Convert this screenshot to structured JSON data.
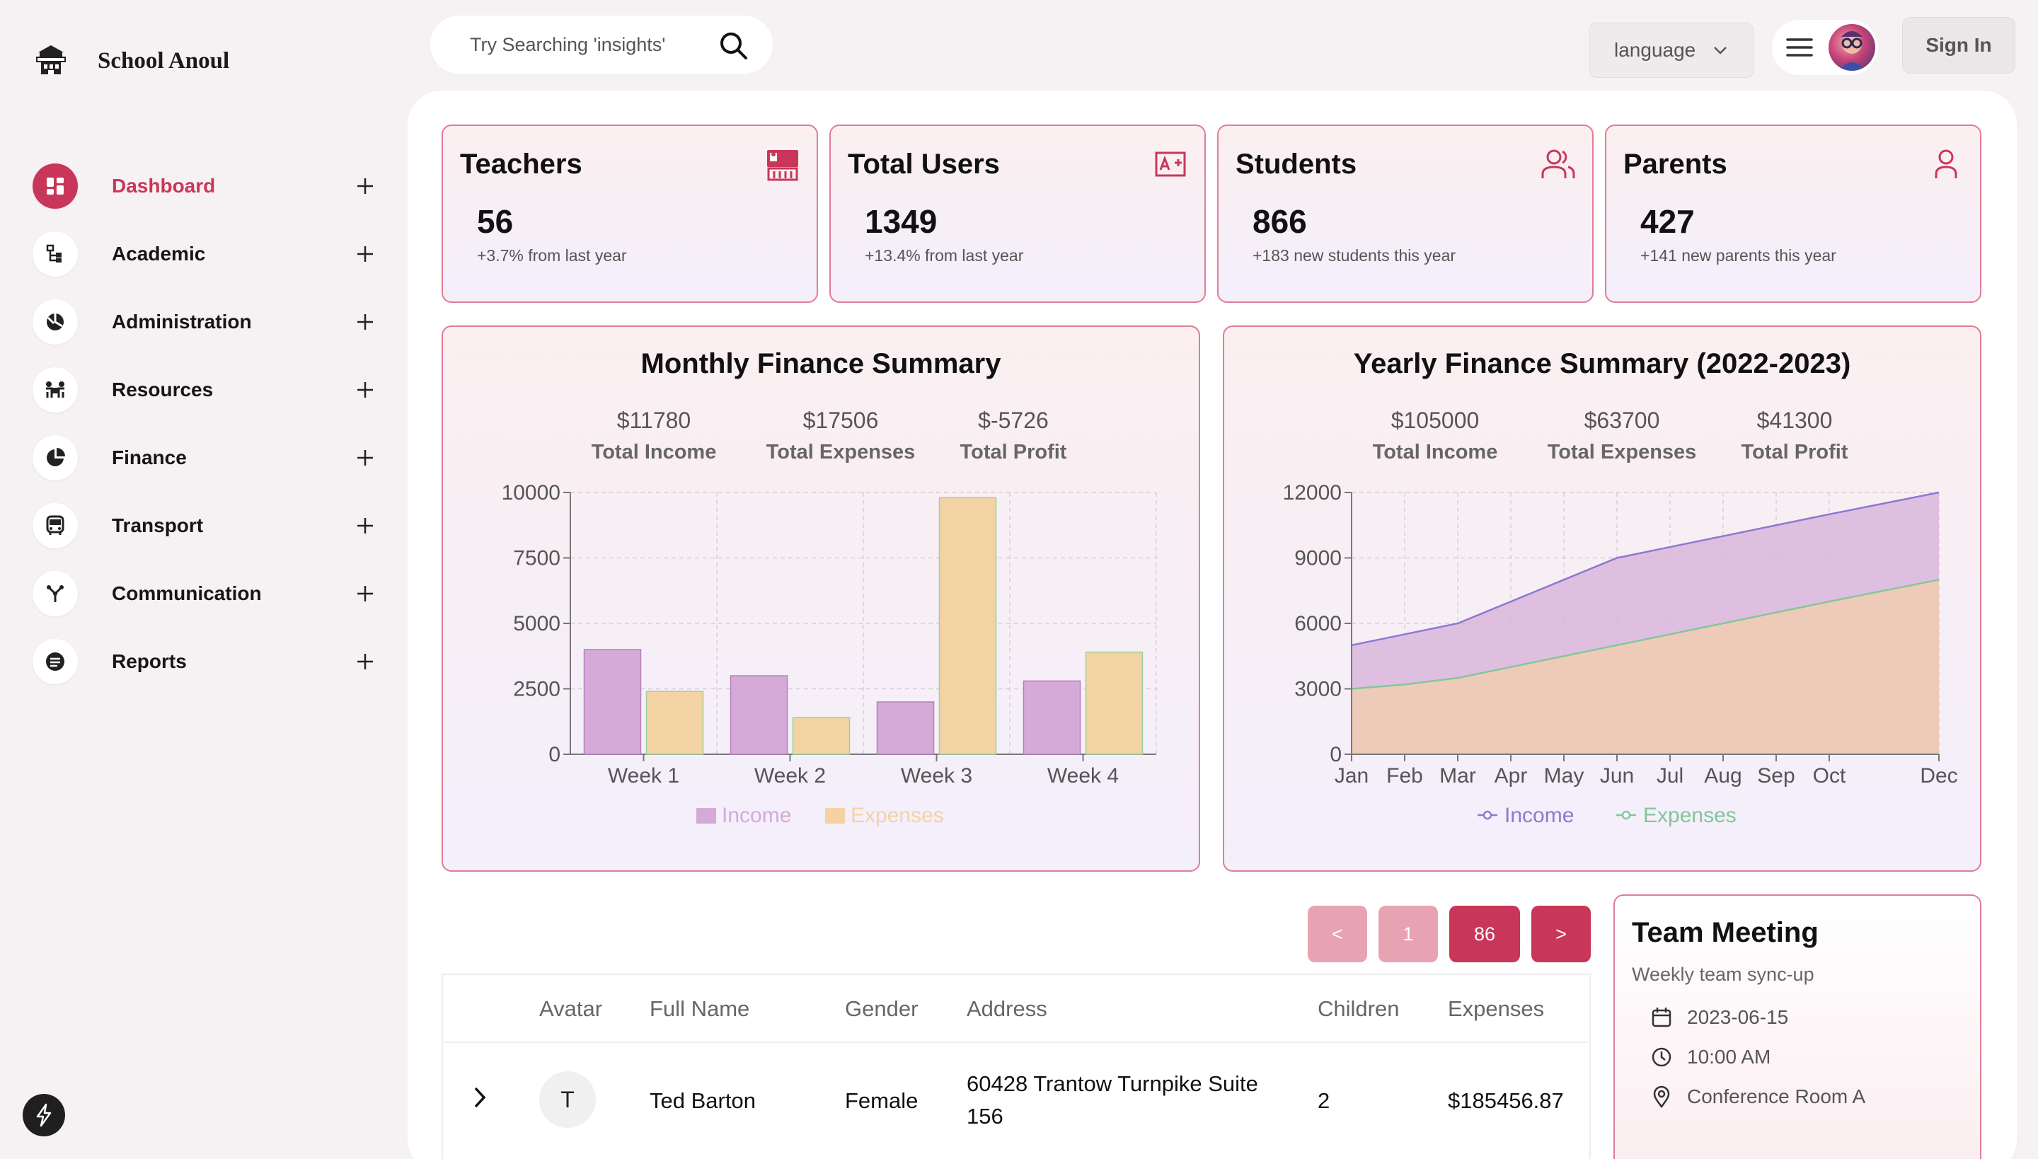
{
  "brand": {
    "name": "School Anoul"
  },
  "sidebar": {
    "items": [
      {
        "label": "Dashboard",
        "icon": "dashboard-icon",
        "active": true
      },
      {
        "label": "Academic",
        "icon": "academic-icon"
      },
      {
        "label": "Administration",
        "icon": "administration-icon"
      },
      {
        "label": "Resources",
        "icon": "resources-icon"
      },
      {
        "label": "Finance",
        "icon": "finance-icon"
      },
      {
        "label": "Transport",
        "icon": "bus-icon"
      },
      {
        "label": "Communication",
        "icon": "communication-icon"
      },
      {
        "label": "Reports",
        "icon": "reports-icon"
      }
    ]
  },
  "header": {
    "search_placeholder": "Try Searching 'insights'",
    "language_label": "language",
    "sign_in_label": "Sign In"
  },
  "stats": [
    {
      "title": "Teachers",
      "value": "56",
      "sub": "+3.7% from last year",
      "icon": "teacher-icon"
    },
    {
      "title": "Total Users",
      "value": "1349",
      "sub": "+13.4% from last year",
      "icon": "grade-icon"
    },
    {
      "title": "Students",
      "value": "866",
      "sub": "+183 new students this year",
      "icon": "students-icon"
    },
    {
      "title": "Parents",
      "value": "427",
      "sub": "+141 new parents this year",
      "icon": "parent-icon"
    }
  ],
  "monthly": {
    "title": "Monthly Finance Summary",
    "income_value": "$11780",
    "income_label": "Total Income",
    "expenses_value": "$17506",
    "expenses_label": "Total Expenses",
    "profit_value": "$-5726",
    "profit_label": "Total Profit"
  },
  "yearly": {
    "title": "Yearly Finance Summary (2022-2023)",
    "income_value": "$105000",
    "income_label": "Total Income",
    "expenses_value": "$63700",
    "expenses_label": "Total Expenses",
    "profit_value": "$41300",
    "profit_label": "Total Profit"
  },
  "chart_data": [
    {
      "type": "bar",
      "categories": [
        "Week 1",
        "Week 2",
        "Week 3",
        "Week 4"
      ],
      "series": [
        {
          "name": "Income",
          "values": [
            4000,
            3000,
            2000,
            2800
          ],
          "color": "#d5aad8"
        },
        {
          "name": "Expenses",
          "values": [
            2400,
            1400,
            9800,
            3900
          ],
          "color": "#f3d3a4"
        }
      ],
      "yticks": [
        0,
        2500,
        5000,
        7500,
        10000
      ],
      "ylim": [
        0,
        10000
      ],
      "grid": true,
      "legend": "bottom"
    },
    {
      "type": "area",
      "x": [
        "Jan",
        "Feb",
        "Mar",
        "Apr",
        "May",
        "Jun",
        "Jul",
        "Aug",
        "Sep",
        "Oct",
        "Dec"
      ],
      "series": [
        {
          "name": "Income",
          "values": [
            5000,
            5500,
            6000,
            7000,
            8000,
            9000,
            9500,
            10000,
            10500,
            11000,
            12000
          ],
          "color": "#8e78cf"
        },
        {
          "name": "Expenses",
          "values": [
            3000,
            3200,
            3500,
            4000,
            4500,
            5000,
            5500,
            6000,
            6500,
            7000,
            8000
          ],
          "color": "#82c79c"
        }
      ],
      "yticks": [
        0,
        3000,
        6000,
        9000,
        12000
      ],
      "ylim": [
        0,
        12000
      ],
      "grid": true,
      "legend": "bottom"
    }
  ],
  "pagination": {
    "prev": "<",
    "page1": "1",
    "last": "86",
    "next": ">"
  },
  "table": {
    "headers": [
      "Avatar",
      "Full Name",
      "Gender",
      "Address",
      "Children",
      "Expenses"
    ],
    "rows": [
      {
        "initial": "T",
        "name": "Ted Barton",
        "gender": "Female",
        "address_line1": "60428 Trantow Turnpike Suite",
        "address_line2": "156",
        "children": "2",
        "expenses": "$185456.87"
      }
    ]
  },
  "meeting": {
    "title": "Team Meeting",
    "subtitle": "Weekly team sync-up",
    "date": "2023-06-15",
    "time": "10:00 AM",
    "location": "Conference Room A"
  }
}
